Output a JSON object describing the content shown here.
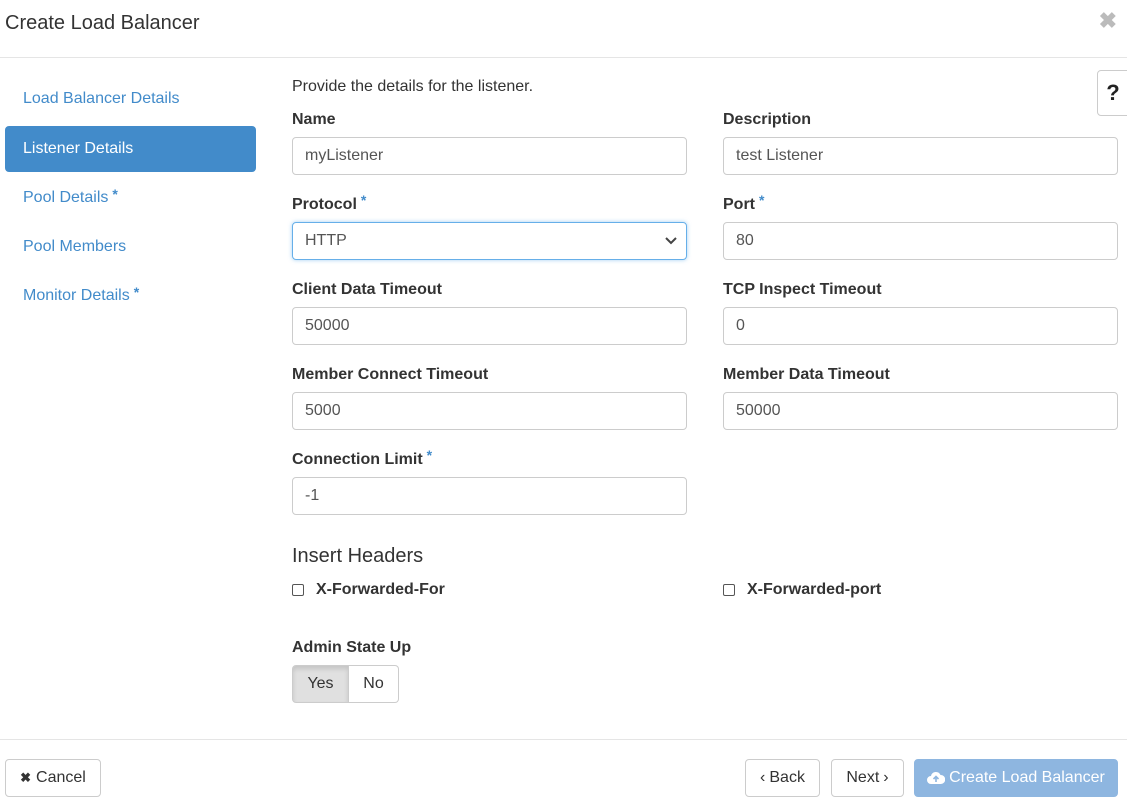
{
  "dialog": {
    "title": "Create Load Balancer",
    "close_icon": "close-icon"
  },
  "sidebar": {
    "items": [
      {
        "label": "Load Balancer Details",
        "required": false,
        "active": false
      },
      {
        "label": "Listener Details",
        "required": false,
        "active": true
      },
      {
        "label": "Pool Details",
        "required": true,
        "active": false
      },
      {
        "label": "Pool Members",
        "required": false,
        "active": false
      },
      {
        "label": "Monitor Details",
        "required": true,
        "active": false
      }
    ]
  },
  "form": {
    "intro": "Provide the details for the listener.",
    "required_mark": "*",
    "name": {
      "label": "Name",
      "value": "myListener"
    },
    "description": {
      "label": "Description",
      "value": "test Listener"
    },
    "protocol": {
      "label": "Protocol",
      "value": "HTTP"
    },
    "port": {
      "label": "Port",
      "value": "80"
    },
    "client_data_timeout": {
      "label": "Client Data Timeout",
      "value": "50000"
    },
    "tcp_inspect_timeout": {
      "label": "TCP Inspect Timeout",
      "value": "0"
    },
    "member_connect_timeout": {
      "label": "Member Connect Timeout",
      "value": "5000"
    },
    "member_data_timeout": {
      "label": "Member Data Timeout",
      "value": "50000"
    },
    "connection_limit": {
      "label": "Connection Limit",
      "value": "-1"
    },
    "insert_headers": {
      "title": "Insert Headers",
      "x_forwarded_for": "X-Forwarded-For",
      "x_forwarded_port": "X-Forwarded-port"
    },
    "admin_state": {
      "label": "Admin State Up",
      "yes": "Yes",
      "no": "No",
      "selected": "Yes"
    }
  },
  "footer": {
    "cancel": "Cancel",
    "back": "Back",
    "next": "Next",
    "create": "Create Load Balancer"
  },
  "colors": {
    "accent": "#428bca",
    "create_disabled": "#8eb6e0"
  }
}
